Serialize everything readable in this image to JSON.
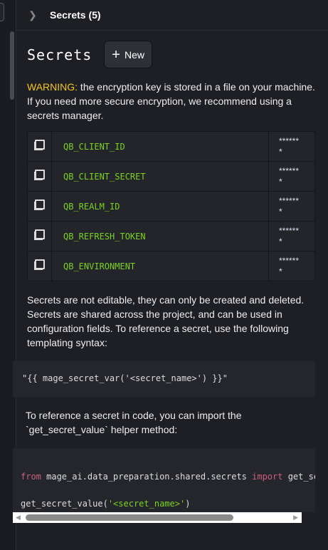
{
  "header": {
    "title": "Secrets (5)"
  },
  "main": {
    "title": "Secrets",
    "new_label": "New",
    "warning_label": "WARNING:",
    "warning_text": " the encryption key is stored in a file on your machine. If you need more secure encryption, we recommend using a secrets manager.",
    "secrets": [
      {
        "name": "QB_CLIENT_ID",
        "value": "*******"
      },
      {
        "name": "QB_CLIENT_SECRET",
        "value": "*******"
      },
      {
        "name": "QB_REALM_ID",
        "value": "*******"
      },
      {
        "name": "QB_REFRESH_TOKEN",
        "value": "*******"
      },
      {
        "name": "QB_ENVIRONMENT",
        "value": "*******"
      }
    ],
    "info_text": "Secrets are not editable, they can only be created and deleted. Secrets are shared across the project, and can be used in configuration fields. To reference a secret, use the following templating syntax:",
    "template_code": "\"{{ mage_secret_var('<secret_name>') }}\"",
    "code_intro": "To reference a secret in code, you can import the `get_secret_value` helper method:",
    "code": {
      "kw_from": "from",
      "module": " mage_ai.data_preparation.shared.secrets ",
      "kw_import": "import",
      "rest": " get_secret_value",
      "call_start": "get_secret_value(",
      "call_arg": "'<secret_name>'",
      "call_end": ")"
    }
  }
}
